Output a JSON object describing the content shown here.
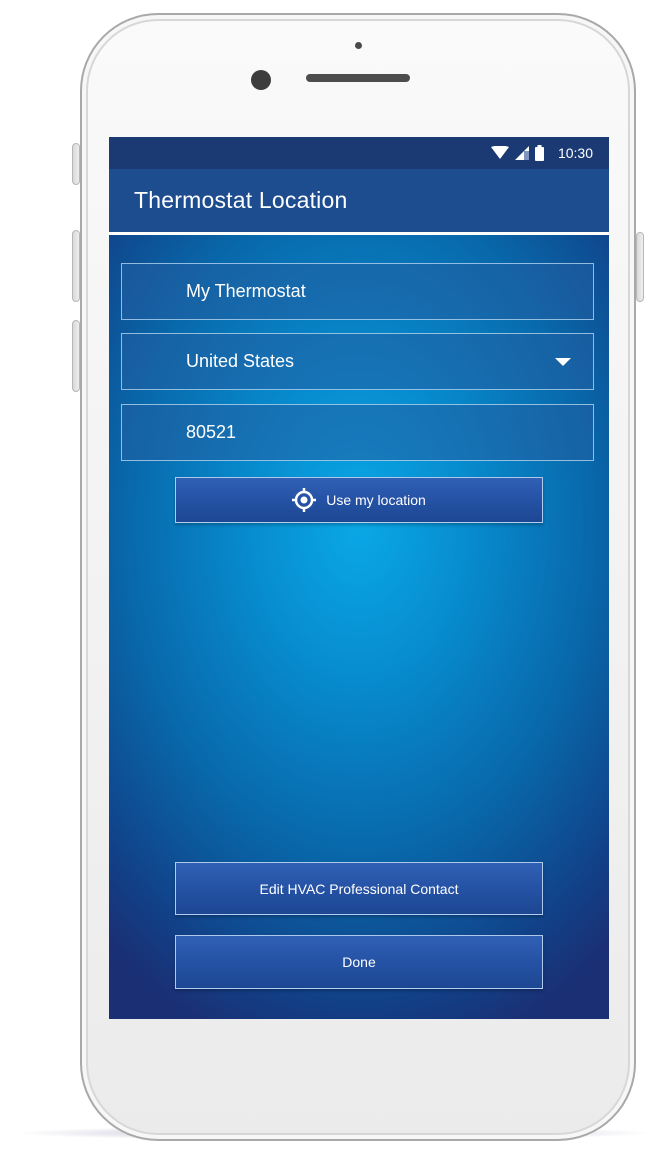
{
  "status_bar": {
    "time": "10:30",
    "icons": [
      "wifi-icon",
      "signal-icon",
      "battery-icon"
    ]
  },
  "app_bar": {
    "title": "Thermostat Location"
  },
  "form": {
    "name_value": "My Thermostat",
    "country_value": "United States",
    "zip_value": "80521"
  },
  "buttons": {
    "use_location_label": "Use my location",
    "use_location_icon": "location-target-icon",
    "edit_hvac_label": "Edit HVAC Professional Contact",
    "done_label": "Done"
  },
  "colors": {
    "status_bar": "#1b3a74",
    "app_bar": "#1d4d8f",
    "background_center": "#0aa8e6",
    "background_edge": "#1b2f74",
    "button": "#2552a5"
  }
}
